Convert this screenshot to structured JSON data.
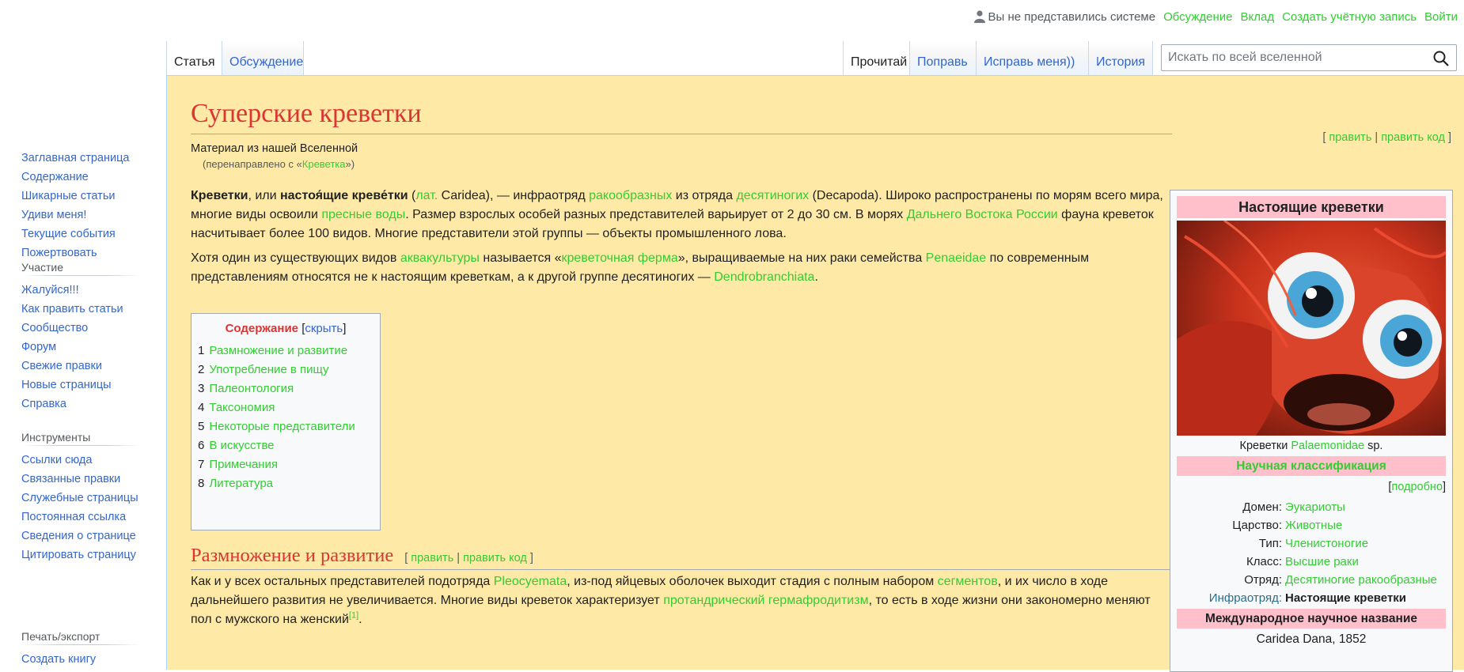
{
  "personal": {
    "anon": "Вы не представились системе",
    "links": [
      "Обсуждение",
      "Вклад",
      "Создать учётную запись",
      "Войти"
    ]
  },
  "sidebar": {
    "nav": [
      "Заглавная страница",
      "Содержание",
      "Шикарные статьи",
      "Удиви меня!",
      "Текущие события",
      "Пожертвовать"
    ],
    "participate": {
      "title": "Участие",
      "items": [
        "Жалуйся!!!",
        "Как править статьи",
        "Сообщество",
        "Форум",
        "Свежие правки",
        "Новые страницы",
        "Справка"
      ]
    },
    "tools": {
      "title": "Инструменты",
      "items": [
        "Ссылки сюда",
        "Связанные правки",
        "Служебные страницы",
        "Постоянная ссылка",
        "Сведения о странице",
        "Цитировать страницу"
      ]
    },
    "print": {
      "title": "Печать/экспорт",
      "items": [
        "Создать книгу"
      ]
    }
  },
  "tabs": {
    "left": [
      "Статья",
      "Обсуждение"
    ],
    "right": [
      "Прочитай",
      "Поправь",
      "Исправь меня))",
      "История"
    ]
  },
  "search": {
    "placeholder": "Искать по всей вселенной"
  },
  "article": {
    "title": "Суперские креветки",
    "edit_top": {
      "open": "[ ",
      "edit": "править",
      "sep": " | ",
      "edit_code": "править код",
      "close": " ]"
    },
    "site_sub": "Материал из нашей Вселенной",
    "redirect": {
      "pre": "(перенаправлено с «",
      "link": "Креветка",
      "post": "»)"
    },
    "p1": {
      "b1": "Креветки",
      "t1": ", или ",
      "b2": "настоя́щие креве́тки",
      "t2": " (",
      "l1": "лат.",
      "t3": " Caridea), — инфраотряд ",
      "l2": "ракообразных",
      "t4": " из отряда ",
      "l3": "десятиногих",
      "t5": " (Decapoda). Широко распространены по морям всего мира, многие виды освоили ",
      "l4": "пресные воды",
      "t6": ". Размер взрослых особей разных представителей варьирует от 2 до 30 см. В морях ",
      "l5": "Дальнего Востока России",
      "t7": " фауна креветок насчитывает более 100 видов. Многие представители этой группы — объекты промышленного лова."
    },
    "p2": {
      "t1": "Хотя один из существующих видов ",
      "l1": "аквакультуры",
      "t2": " называется «",
      "l2": "креветочная ферма",
      "t3": "», выращиваемые на них раки семейства ",
      "l3": "Penaeidae",
      "t4": " по современным представлениям относятся не к настоящим креветкам, а к другой группе десятиногих — ",
      "l4": "Dendrobranchiata",
      "t5": "."
    }
  },
  "toc": {
    "title": "Содержание",
    "hide": "скрыть",
    "items": [
      {
        "num": "1",
        "label": "Размножение и развитие"
      },
      {
        "num": "2",
        "label": "Употребление в пищу"
      },
      {
        "num": "3",
        "label": "Палеонтология"
      },
      {
        "num": "4",
        "label": "Таксономия"
      },
      {
        "num": "5",
        "label": "Некоторые представители"
      },
      {
        "num": "6",
        "label": "В искусстве"
      },
      {
        "num": "7",
        "label": "Примечания"
      },
      {
        "num": "8",
        "label": "Литература"
      }
    ]
  },
  "section1": {
    "title": "Размножение и развитие",
    "edit": "править",
    "edit_code": "править код",
    "t1": "Как и у всех остальных представителей подотряда ",
    "l1": "Pleocyemata",
    "t2": ", из-под яйцевых оболочек выходит стадия с полным набором ",
    "l2": "сегментов",
    "t3": ", и их число в ходе дальнейшего развития не увеличивается. Многие виды креветок характеризует ",
    "l3": "протандрический гермафродитизм",
    "t4": ", то есть в ходе жизни они закономерно меняют пол с мужского на женский",
    "ref": "[1]",
    "t5": "."
  },
  "infobox": {
    "title": "Настоящие креветки",
    "caption_pre": "Креветки ",
    "caption_link": "Palaemonidae",
    "caption_post": " sp.",
    "sci_class": "Научная классификация",
    "more": "подробно",
    "rows": [
      {
        "k": "Домен:",
        "v": "Эукариоты",
        "link": true
      },
      {
        "k": "Царство:",
        "v": "Животные",
        "link": true
      },
      {
        "k": "Тип:",
        "v": "Членистоногие",
        "link": true
      },
      {
        "k": "Класс:",
        "v": "Высшие раки",
        "link": true
      },
      {
        "k": "Отряд:",
        "v": "Десятиногие ракообразные",
        "link": true
      },
      {
        "k": "Инфраотряд:",
        "v": "Настоящие креветки",
        "link": false
      }
    ],
    "intl": "Международное научное название",
    "author": "Caridea Dana, 1852"
  }
}
